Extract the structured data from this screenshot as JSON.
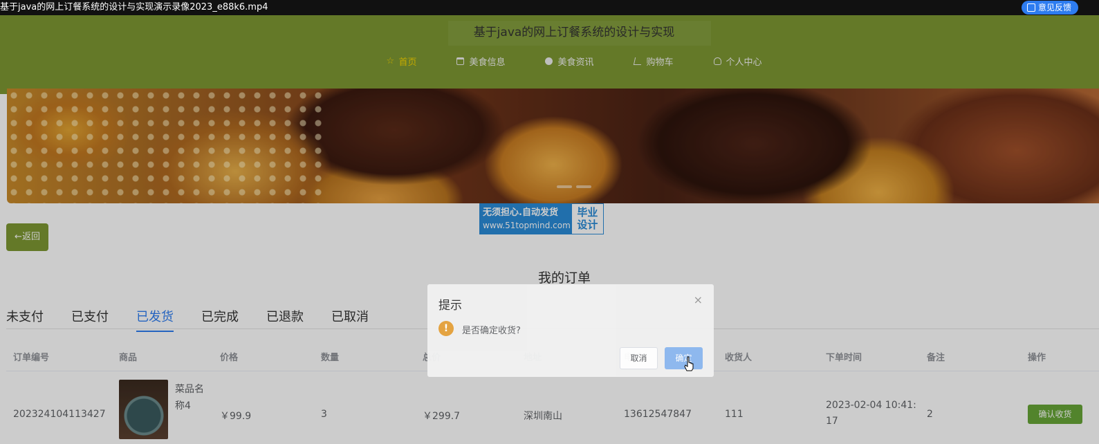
{
  "video": {
    "title": "基于java的网上订餐系统的设计与实现演示录像2023_e88k6.mp4",
    "feedback": "意见反馈"
  },
  "site": {
    "title": "基于java的网上订餐系统的设计与实现"
  },
  "nav": [
    {
      "label": "首页",
      "icon": "star-icon"
    },
    {
      "label": "美食信息",
      "icon": "bag-icon"
    },
    {
      "label": "美食资讯",
      "icon": "info-icon"
    },
    {
      "label": "购物车",
      "icon": "cart-icon"
    },
    {
      "label": "个人中心",
      "icon": "user-icon"
    }
  ],
  "watermark": {
    "line1": "无须担心.自动发货",
    "line2": "www.51topmind.com",
    "side1": "毕业",
    "side2": "设计"
  },
  "back": "←返回",
  "orders": {
    "title": "我的订单",
    "tabs": [
      "未支付",
      "已支付",
      "已发货",
      "已完成",
      "已退款",
      "已取消"
    ],
    "columns": [
      "订单编号",
      "商品",
      "价格",
      "数量",
      "总价",
      "地址",
      "电话",
      "收货人",
      "下单时间",
      "备注",
      "操作"
    ],
    "row": {
      "order_no": "202324104113427",
      "dish_name_1": "菜品名",
      "dish_name_2": "称4",
      "price": "￥99.9",
      "qty": "3",
      "total": "￥299.7",
      "address": "深圳南山",
      "phone": "13612547847",
      "receiver": "111",
      "time_1": "2023-02-04 10:41:",
      "time_2": "17",
      "note": "2",
      "action": "确认收货"
    }
  },
  "dialog": {
    "title": "提示",
    "close": "×",
    "warn": "!",
    "message": "是否确定收货?",
    "cancel": "取消",
    "ok": "确定"
  },
  "colors": {
    "header": "#7d9832",
    "active_nav": "#f5d400",
    "primary": "#2d7cf0",
    "success": "#67a538",
    "warning": "#e6a23c"
  }
}
